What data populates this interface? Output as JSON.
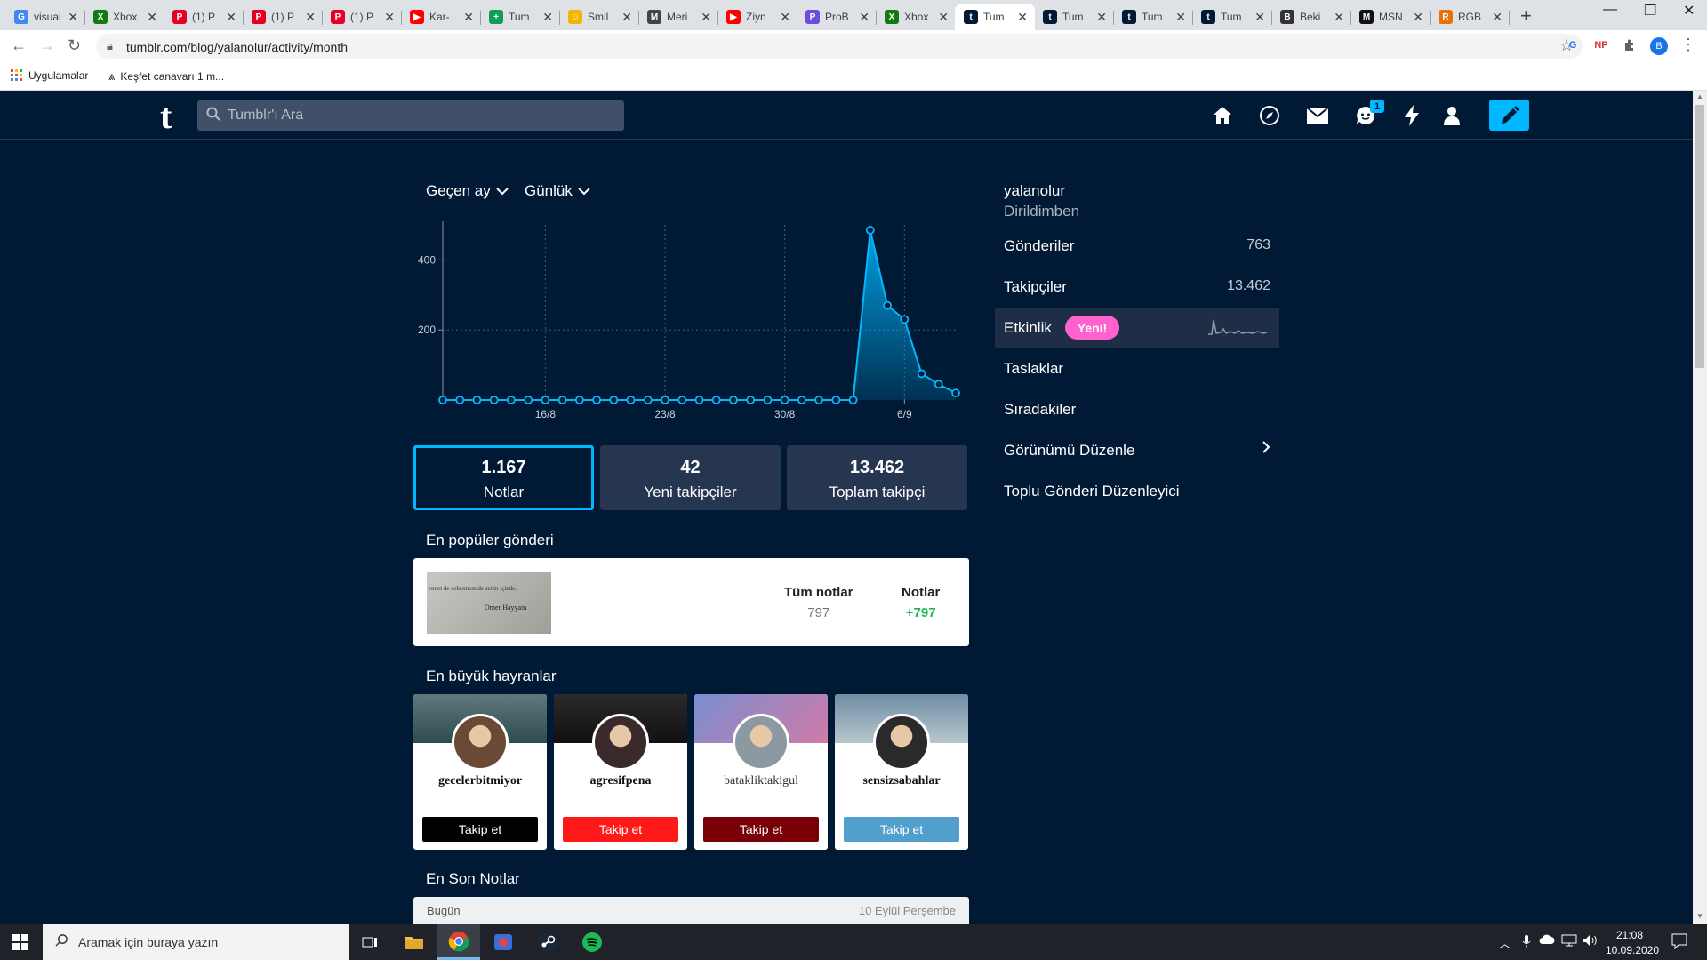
{
  "browser": {
    "tabs": [
      {
        "title": "visual",
        "icon_text": "G",
        "icon_color": "#4285f4"
      },
      {
        "title": "Xbox",
        "icon_text": "X",
        "icon_color": "#107c10"
      },
      {
        "title": "(1) P",
        "icon_text": "P",
        "icon_color": "#e60023"
      },
      {
        "title": "(1) P",
        "icon_text": "P",
        "icon_color": "#e60023"
      },
      {
        "title": "(1) P",
        "icon_text": "P",
        "icon_color": "#e60023"
      },
      {
        "title": "Kar-",
        "icon_text": "▶",
        "icon_color": "#ff0000"
      },
      {
        "title": "Tum",
        "icon_text": "+",
        "icon_color": "#0f9d58"
      },
      {
        "title": "Smil",
        "icon_text": "☺",
        "icon_color": "#f4b400"
      },
      {
        "title": "Meri",
        "icon_text": "M",
        "icon_color": "#444444"
      },
      {
        "title": "Ziyn",
        "icon_text": "▶",
        "icon_color": "#ff0000"
      },
      {
        "title": "ProB",
        "icon_text": "P",
        "icon_color": "#6c4be0"
      },
      {
        "title": "Xbox",
        "icon_text": "X",
        "icon_color": "#107c10"
      },
      {
        "title": "Tum",
        "icon_text": "t",
        "icon_color": "#001935"
      },
      {
        "title": "Tum",
        "icon_text": "t",
        "icon_color": "#001935"
      },
      {
        "title": "Tum",
        "icon_text": "t",
        "icon_color": "#001935"
      },
      {
        "title": "Tum",
        "icon_text": "t",
        "icon_color": "#001935"
      },
      {
        "title": "Beki",
        "icon_text": "B",
        "icon_color": "#333333"
      },
      {
        "title": "MSN",
        "icon_text": "M",
        "icon_color": "#111111"
      },
      {
        "title": "RGB",
        "icon_text": "R",
        "icon_color": "#e8710a"
      }
    ],
    "active_tab_index": 12,
    "url": "tumblr.com/blog/yalanolur/activity/month",
    "bookmarks": [
      {
        "label": "Uygulamalar",
        "icon": "apps-grid-icon"
      },
      {
        "label": "Keşfet canavarı 1 m...",
        "icon": "bookmark-favicon-icon"
      }
    ],
    "extensions": [
      {
        "label": "G",
        "color": "#1a73e8"
      },
      {
        "label": "NP",
        "color": "#d93025"
      },
      {
        "label": "✚",
        "color": "#5f6368"
      }
    ],
    "profile_initial": "B"
  },
  "tumblr": {
    "logo": "t",
    "search_placeholder": "Tumblr'ı Ara",
    "notification_count": "1",
    "accent": "#00b8ff",
    "background": "#001935"
  },
  "activity": {
    "range": "Geçen ay",
    "granularity": "Günlük",
    "stats": [
      {
        "value": "1.167",
        "label": "Notlar"
      },
      {
        "value": "42",
        "label": "Yeni takipçiler"
      },
      {
        "value": "13.462",
        "label": "Toplam takipçi"
      }
    ],
    "active_stat_index": 0,
    "popular_heading": "En popüler gönderi",
    "popular_post": {
      "thumb_text_1": "ennet de cehennem de senin içinde.",
      "thumb_text_2": "Ömer Hayyam",
      "all_notes_label": "Tüm notlar",
      "all_notes_value": "797",
      "notes_label": "Notlar",
      "notes_value": "+797"
    },
    "fans_heading": "En büyük hayranlar",
    "fans": [
      {
        "name": "gecelerbitmiyor",
        "button": "Takip et",
        "button_color": "#000000",
        "cover": "linear-gradient(180deg,#5e7a7e,#2f4a50)",
        "avatar": "#6b4a35"
      },
      {
        "name": "agresifpena",
        "button": "Takip et",
        "button_color": "#ff1a1a",
        "cover": "linear-gradient(180deg,#2a2a2a,#111111)",
        "avatar": "#3a2a2a"
      },
      {
        "name": "batakliktakigul",
        "button": "Takip et",
        "button_color": "#7a0008",
        "cover": "linear-gradient(135deg,#7a8fd0,#d07aa8)",
        "avatar": "#8a9aa0"
      },
      {
        "name": "sensizsabahlar",
        "button": "Takip et",
        "button_color": "#529ecc",
        "cover": "linear-gradient(180deg,#6f8ea5,#b8c6cc)",
        "avatar": "#2a2a2a"
      }
    ],
    "latest_heading": "En Son Notlar",
    "latest": {
      "left": "Bugün",
      "right": "10 Eylül Perşembe"
    }
  },
  "chart_data": {
    "type": "area",
    "x": [
      "10/8",
      "11/8",
      "12/8",
      "13/8",
      "14/8",
      "15/8",
      "16/8",
      "17/8",
      "18/8",
      "19/8",
      "20/8",
      "21/8",
      "22/8",
      "23/8",
      "24/8",
      "25/8",
      "26/8",
      "27/8",
      "28/8",
      "29/8",
      "30/8",
      "31/8",
      "1/9",
      "2/9",
      "3/9",
      "4/9",
      "5/9",
      "6/9",
      "7/9",
      "8/9",
      "9/9"
    ],
    "values": [
      0,
      0,
      0,
      0,
      0,
      0,
      0,
      0,
      0,
      0,
      0,
      0,
      0,
      0,
      0,
      0,
      0,
      0,
      0,
      0,
      0,
      0,
      0,
      0,
      0,
      485,
      270,
      230,
      75,
      45,
      20
    ],
    "x_tick_labels": [
      "16/8",
      "23/8",
      "30/8",
      "6/9"
    ],
    "y_ticks": [
      200,
      400
    ],
    "ylim": [
      0,
      500
    ],
    "grid": true,
    "line_color": "#00b8ff"
  },
  "sidebar": {
    "blog_name": "yalanolur",
    "blog_title": "Dirildimben",
    "items": [
      {
        "label": "Gönderiler",
        "count": "763"
      },
      {
        "label": "Takipçiler",
        "count": "13.462"
      },
      {
        "label": "Etkinlik",
        "badge": "Yeni!"
      },
      {
        "label": "Taslaklar"
      },
      {
        "label": "Sıradakiler"
      },
      {
        "label": "Görünümü Düzenle"
      },
      {
        "label": "Toplu Gönderi Düzenleyici"
      }
    ]
  },
  "taskbar": {
    "search_placeholder": "Aramak için buraya yazın",
    "time": "21:08",
    "date": "10.09.2020"
  }
}
